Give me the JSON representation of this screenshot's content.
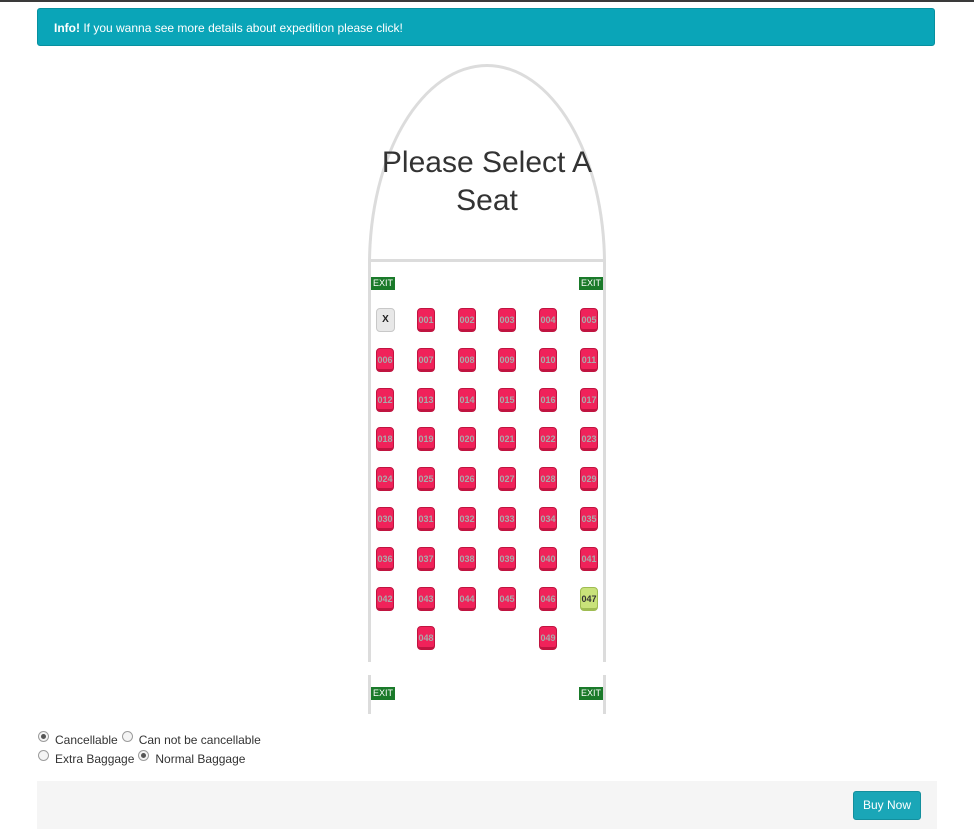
{
  "info": {
    "strong": "Info!",
    "text": " If you wanna see more details about expedition please click!"
  },
  "plane": {
    "title": "Please Select A Seat",
    "exit_label": "EXIT",
    "blocked_label": "X",
    "seat_rows": [
      [
        {
          "label": "X",
          "status": "blocked"
        },
        {
          "label": "001",
          "status": "taken"
        },
        {
          "label": "002",
          "status": "taken"
        },
        {
          "label": "003",
          "status": "taken"
        },
        {
          "label": "004",
          "status": "taken"
        },
        {
          "label": "005",
          "status": "taken"
        }
      ],
      [
        {
          "label": "006",
          "status": "taken"
        },
        {
          "label": "007",
          "status": "taken"
        },
        {
          "label": "008",
          "status": "taken"
        },
        {
          "label": "009",
          "status": "taken"
        },
        {
          "label": "010",
          "status": "taken"
        },
        {
          "label": "011",
          "status": "taken"
        }
      ],
      [
        {
          "label": "012",
          "status": "taken"
        },
        {
          "label": "013",
          "status": "taken"
        },
        {
          "label": "014",
          "status": "taken"
        },
        {
          "label": "015",
          "status": "taken"
        },
        {
          "label": "016",
          "status": "taken"
        },
        {
          "label": "017",
          "status": "taken"
        }
      ],
      [
        {
          "label": "018",
          "status": "taken"
        },
        {
          "label": "019",
          "status": "taken"
        },
        {
          "label": "020",
          "status": "taken"
        },
        {
          "label": "021",
          "status": "taken"
        },
        {
          "label": "022",
          "status": "taken"
        },
        {
          "label": "023",
          "status": "taken"
        }
      ],
      [
        {
          "label": "024",
          "status": "taken"
        },
        {
          "label": "025",
          "status": "taken"
        },
        {
          "label": "026",
          "status": "taken"
        },
        {
          "label": "027",
          "status": "taken"
        },
        {
          "label": "028",
          "status": "taken"
        },
        {
          "label": "029",
          "status": "taken"
        }
      ],
      [
        {
          "label": "030",
          "status": "taken"
        },
        {
          "label": "031",
          "status": "taken"
        },
        {
          "label": "032",
          "status": "taken"
        },
        {
          "label": "033",
          "status": "taken"
        },
        {
          "label": "034",
          "status": "taken"
        },
        {
          "label": "035",
          "status": "taken"
        }
      ],
      [
        {
          "label": "036",
          "status": "taken"
        },
        {
          "label": "037",
          "status": "taken"
        },
        {
          "label": "038",
          "status": "taken"
        },
        {
          "label": "039",
          "status": "taken"
        },
        {
          "label": "040",
          "status": "taken"
        },
        {
          "label": "041",
          "status": "taken"
        }
      ],
      [
        {
          "label": "042",
          "status": "taken"
        },
        {
          "label": "043",
          "status": "taken"
        },
        {
          "label": "044",
          "status": "taken"
        },
        {
          "label": "045",
          "status": "taken"
        },
        {
          "label": "046",
          "status": "taken"
        },
        {
          "label": "047",
          "status": "free"
        }
      ],
      [
        null,
        {
          "label": "048",
          "status": "taken"
        },
        null,
        null,
        {
          "label": "049",
          "status": "taken"
        },
        null
      ]
    ]
  },
  "options": {
    "cancel": [
      {
        "label": "Cancellable",
        "checked": true
      },
      {
        "label": "Can not be cancellable",
        "checked": false
      }
    ],
    "baggage": [
      {
        "label": "Extra Baggage",
        "checked": false
      },
      {
        "label": "Normal Baggage",
        "checked": true
      }
    ]
  },
  "footer": {
    "buy_label": "Buy Now"
  },
  "colors": {
    "info": "#0aa5b8",
    "taken_seat": "#f0225a",
    "free_seat": "#c9e27a",
    "exit": "#1a7a2a",
    "buy": "#1aa6b7"
  }
}
